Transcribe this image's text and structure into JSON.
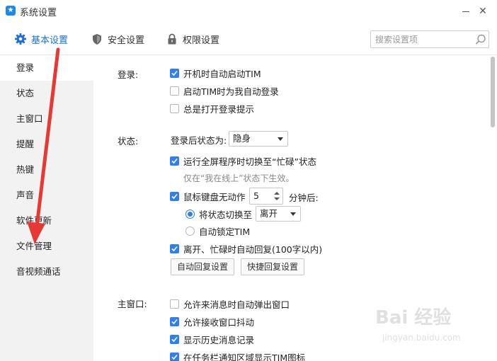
{
  "window": {
    "title": "系统设置"
  },
  "tabs": [
    {
      "label": "基本设置",
      "icon": "gear-icon",
      "active": true
    },
    {
      "label": "安全设置",
      "icon": "shield-icon",
      "active": false
    },
    {
      "label": "权限设置",
      "icon": "lock-icon",
      "active": false
    }
  ],
  "search": {
    "placeholder": "搜索设置项",
    "value": ""
  },
  "sidebar": {
    "items": [
      {
        "label": "登录",
        "active": true
      },
      {
        "label": "状态"
      },
      {
        "label": "主窗口"
      },
      {
        "label": "提醒"
      },
      {
        "label": "热键"
      },
      {
        "label": "声音"
      },
      {
        "label": "软件更新"
      },
      {
        "label": "文件管理"
      },
      {
        "label": "音视频通话"
      }
    ]
  },
  "login": {
    "label": "登录:",
    "options": [
      {
        "label": "开机时自动启动TIM",
        "checked": true
      },
      {
        "label": "启动TIM时为我自动登录",
        "checked": false
      },
      {
        "label": "总是打开登录提示",
        "checked": false
      }
    ]
  },
  "status": {
    "label": "状态:",
    "after_login_label": "登录后状态为:",
    "after_login_value": "隐身",
    "fullscreen_option": {
      "label": "运行全屏程序时切换至“忙碌”状态",
      "checked": true
    },
    "fullscreen_hint": "仅在“我在线上”状态下生效。",
    "idle_option": {
      "label": "鼠标键盘无动作",
      "checked": true
    },
    "idle_minutes": "5",
    "idle_suffix": "分钟后:",
    "switch_status": {
      "label": "将状态切换至",
      "checked": true,
      "value": "离开"
    },
    "auto_lock": {
      "label": "自动锁定TIM",
      "checked": false
    },
    "auto_reply": {
      "label": "离开、忙碌时自动回复(100字以内)",
      "checked": true
    },
    "buttons": {
      "auto_reply_settings": "自动回复设置",
      "quick_reply_settings": "快捷回复设置"
    }
  },
  "main_window": {
    "label": "主窗口:",
    "options": [
      {
        "label": "允许来消息时自动弹出窗口",
        "checked": false
      },
      {
        "label": "允许接收窗口抖动",
        "checked": true
      },
      {
        "label": "显示历史消息记录",
        "checked": true
      },
      {
        "label": "在任务栏通知区域显示TIM图标",
        "checked": true
      }
    ]
  },
  "watermark": {
    "brand": "Bai 经验",
    "sub": "jingyan.baidu.com"
  },
  "colors": {
    "accent": "#2f80ed",
    "annotation_arrow": "#e53935",
    "sidebar_bg": "#f2f2f2"
  }
}
